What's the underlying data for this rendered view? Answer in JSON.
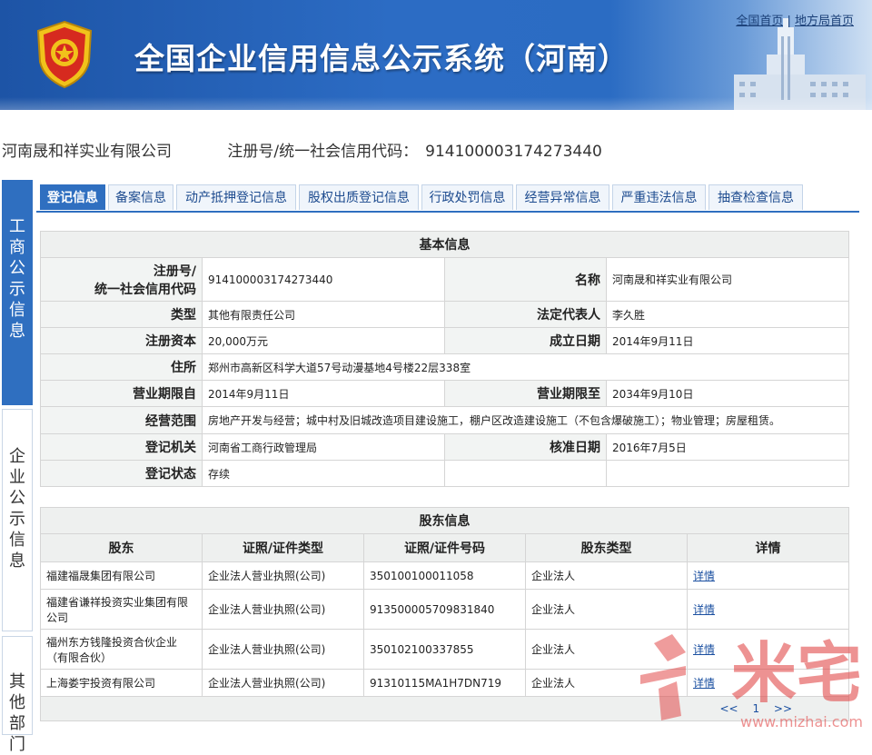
{
  "header": {
    "title": "全国企业信用信息公示系统（河南）",
    "links": [
      "全国首页",
      "地方局首页"
    ]
  },
  "company": {
    "name": "河南晟和祥实业有限公司",
    "reg_label": "注册号/统一社会信用代码：",
    "reg_no": "914100003174273440"
  },
  "side_tabs": [
    "工商公示信息",
    "企业公示信息",
    "其他部门"
  ],
  "tabs": [
    "登记信息",
    "备案信息",
    "动产抵押登记信息",
    "股权出质登记信息",
    "行政处罚信息",
    "经营异常信息",
    "严重违法信息",
    "抽查检查信息"
  ],
  "basic": {
    "caption": "基本信息",
    "reg_label_1": "注册号/",
    "reg_label_2": "统一社会信用代码",
    "reg_value": "914100003174273440",
    "name_label": "名称",
    "name_value": "河南晟和祥实业有限公司",
    "type_label": "类型",
    "type_value": "其他有限责任公司",
    "rep_label": "法定代表人",
    "rep_value": "李久胜",
    "capital_label": "注册资本",
    "capital_value": "20,000万元",
    "found_label": "成立日期",
    "found_value": "2014年9月11日",
    "address_label": "住所",
    "address_value": "郑州市高新区科学大道57号动漫基地4号楼22层338室",
    "term_from_label": "营业期限自",
    "term_from_value": "2014年9月11日",
    "term_to_label": "营业期限至",
    "term_to_value": "2034年9月10日",
    "scope_label": "经营范围",
    "scope_value": "房地产开发与经营；城中村及旧城改造项目建设施工，棚户区改造建设施工（不包含爆破施工）；物业管理；房屋租赁。",
    "authority_label": "登记机关",
    "authority_value": "河南省工商行政管理局",
    "approve_label": "核准日期",
    "approve_value": "2016年7月5日",
    "status_label": "登记状态",
    "status_value": "存续"
  },
  "shareholders": {
    "caption": "股东信息",
    "columns": [
      "股东",
      "证照/证件类型",
      "证照/证件号码",
      "股东类型",
      "详情"
    ],
    "rows": [
      {
        "name": "福建福晟集团有限公司",
        "cert_type": "企业法人营业执照(公司)",
        "cert_no": "350100100011058",
        "holder_type": "企业法人",
        "detail": "详情"
      },
      {
        "name": "福建省谦祥投资实业集团有限公司",
        "cert_type": "企业法人营业执照(公司)",
        "cert_no": "913500005709831840",
        "holder_type": "企业法人",
        "detail": "详情"
      },
      {
        "name": "福州东方钱隆投资合伙企业（有限合伙）",
        "cert_type": "企业法人营业执照(公司)",
        "cert_no": "350102100337855",
        "holder_type": "企业法人",
        "detail": "详情"
      },
      {
        "name": "上海娄宇投资有限公司",
        "cert_type": "企业法人营业执照(公司)",
        "cert_no": "91310115MA1H7DN719",
        "holder_type": "企业法人",
        "detail": "详情"
      }
    ],
    "pager": {
      "prev": "<<",
      "page": "1",
      "next": ">>"
    }
  },
  "watermark": {
    "text": "米宅",
    "url": "www.mizhai.com"
  },
  "colors": {
    "header_blue": "#2c6cc4",
    "tab_active": "#2f6fc0",
    "link": "#1a4fa0",
    "emblem_red": "#d62a1f",
    "emblem_gold": "#f1c21b"
  }
}
